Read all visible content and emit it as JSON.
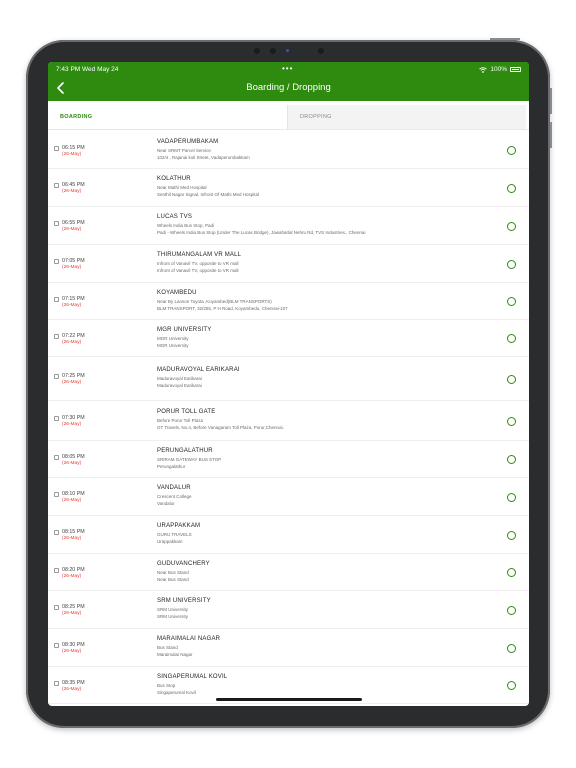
{
  "status": {
    "time": "7:43 PM  Wed May 24",
    "dots": "•••",
    "battery": "100%"
  },
  "header": {
    "title": "Boarding / Dropping"
  },
  "tabs": {
    "boarding": "BOARDING",
    "dropping": "DROPPING"
  },
  "colors": {
    "accent": "#2e8b10",
    "date": "#e23b2d"
  },
  "stops": [
    {
      "time": "06:15 PM",
      "date": "(26-May)",
      "name": "VADAPERUMBAKAM",
      "line1": "Near SRMT Parcel Service",
      "line2": "102/4 , Rajanai koil Street, Vadaperumbakkam"
    },
    {
      "time": "06:45 PM",
      "date": "(26-May)",
      "name": "KOLATHUR",
      "line1": "Near Mathi Med Hospital",
      "line2": "Senthil Nagar Signal, Infront Of Mathi Med Hospital"
    },
    {
      "time": "06:55 PM",
      "date": "(26-May)",
      "name": "LUCAS TVS",
      "line1": "Wheels India Bus Stop, Padi",
      "line2": "Padi - Wheels India Bus Stop (Under The Lucas Bridge), Jawaharlal Nehru Rd, TVS Industries., Chennai"
    },
    {
      "time": "07:05 PM",
      "date": "(26-May)",
      "name": "THIRUMANGALAM VR MALL",
      "line1": "Infront of Vanavil TV, opposite to VR mall",
      "line2": "Infront of Vanavil TV, opposite to VR mall"
    },
    {
      "time": "07:15 PM",
      "date": "(26-May)",
      "name": "KOYAMBEDU",
      "line1": "Near By Lanson Toyota ,Koyambed(BLM TRANSPORTS)",
      "line2": "BLM TRANSPORT, 32/255, P H Road, Koyambedu, Chennai-107"
    },
    {
      "time": "07:22 PM",
      "date": "(26-May)",
      "name": "MGR UNIVERSITY",
      "line1": "MGR University",
      "line2": "MGR University"
    },
    {
      "time": "07:25 PM",
      "date": "(26-May)",
      "name": "MADURAVOYAL EARIKARAI",
      "line1": "Maduravoyal Earikarai",
      "line2": "Maduravoyal Earikarai"
    },
    {
      "time": "07:30 PM",
      "date": "(26-May)",
      "name": "PORUR TOLL GATE",
      "line1": "Before Porur Toll Plaza",
      "line2": "GT Travels, No.4, Before Vanagaram Toll Plaza, Porur,Chennai."
    },
    {
      "time": "08:05 PM",
      "date": "(26-May)",
      "name": "PERUNGALATHUR",
      "line1": "SRIRAM GATEWAY BUS STOP",
      "line2": "Perungalathur"
    },
    {
      "time": "08:10 PM",
      "date": "(26-May)",
      "name": "VANDALUR",
      "line1": "Crescent College",
      "line2": "Vandalur"
    },
    {
      "time": "08:15 PM",
      "date": "(26-May)",
      "name": "URAPPAKKAM",
      "line1": "GURU TRAVELS",
      "line2": "Urappakkam"
    },
    {
      "time": "08:20 PM",
      "date": "(26-May)",
      "name": "GUDUVANCHERY",
      "line1": "Near Bus Stand",
      "line2": "Near Bus Stand"
    },
    {
      "time": "08:25 PM",
      "date": "(26-May)",
      "name": "SRM UNIVERSITY",
      "line1": "SRM University",
      "line2": "SRM University"
    },
    {
      "time": "08:30 PM",
      "date": "(26-May)",
      "name": "MARAIMALAI NAGAR",
      "line1": "Bus Stand",
      "line2": "Maraimalai Nagar"
    },
    {
      "time": "08:35 PM",
      "date": "(26-May)",
      "name": "SINGAPERUMAL KOVIL",
      "line1": "Bus Stop",
      "line2": "Singaperumal Kovil"
    }
  ]
}
